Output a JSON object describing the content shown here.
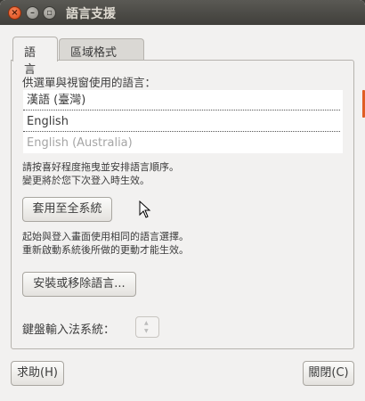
{
  "window": {
    "title": "語言支援"
  },
  "tabs": [
    {
      "label": "語言"
    },
    {
      "label": "區域格式"
    }
  ],
  "language_panel": {
    "list_label": "供選單與視窗使用的語言：",
    "languages": [
      {
        "label": "漢語 (臺灣)"
      },
      {
        "label": "English"
      },
      {
        "label": "English (Australia)"
      }
    ],
    "drag_hint_line1": "請按喜好程度拖曳並安排語言順序。",
    "drag_hint_line2": "變更將於您下次登入時生效。",
    "apply_button": "套用至全系統",
    "apply_hint_line1": "起始與登入畫面使用相同的語言選擇。",
    "apply_hint_line2": "重新啟動系統後所做的更動才能生效。",
    "install_button": "安裝或移除語言...",
    "input_method_label": "鍵盤輸入法系統：",
    "input_method_value": ""
  },
  "footer": {
    "help_button": "求助(H)",
    "close_button": "關閉(C)"
  },
  "colors": {
    "accent": "#e05e23",
    "titlebar": "#403f3b",
    "window_bg": "#f2f1f0"
  }
}
